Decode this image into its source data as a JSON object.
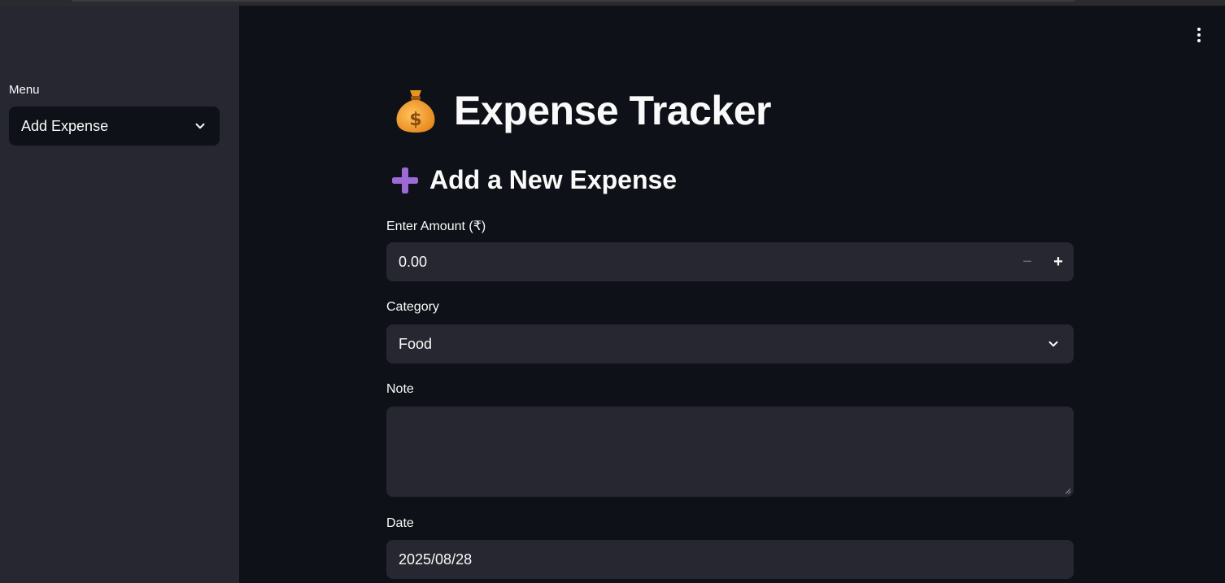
{
  "sidebar": {
    "menu_label": "Menu",
    "menu_value": "Add Expense"
  },
  "header": {
    "title_emoji": "💰",
    "title": "Expense Tracker",
    "subtitle_emoji": "➕",
    "subtitle": "Add a New Expense"
  },
  "form": {
    "amount_label": "Enter Amount (₹)",
    "amount_value": "0.00",
    "minus_symbol": "−",
    "plus_symbol": "+",
    "category_label": "Category",
    "category_value": "Food",
    "note_label": "Note",
    "note_value": "",
    "date_label": "Date",
    "date_value": "2025/08/28"
  },
  "colors": {
    "background": "#0e1117",
    "sidebar": "#262730",
    "input": "#262730"
  }
}
